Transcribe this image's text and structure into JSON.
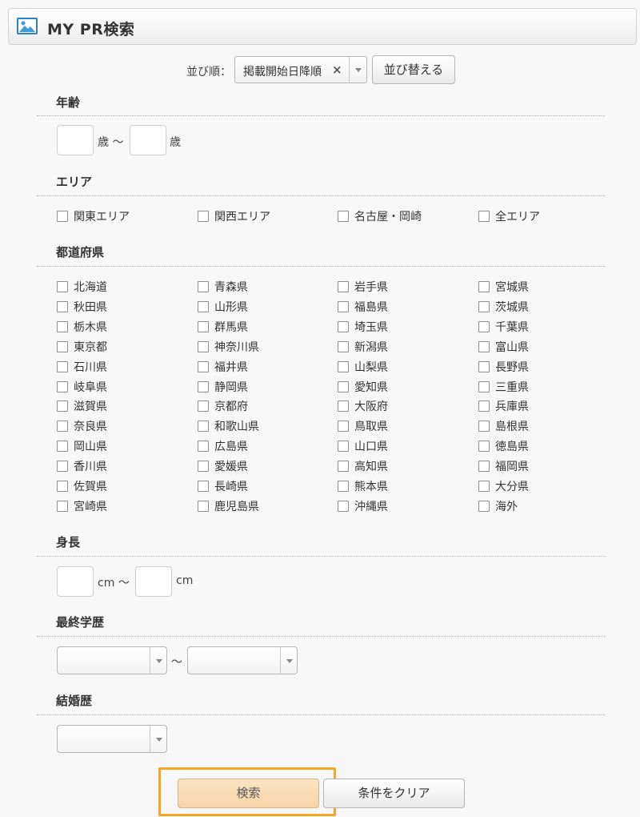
{
  "header": {
    "title": "MY PR検索",
    "icon": "image-icon"
  },
  "sort": {
    "label": "並び順：",
    "selected": "掲載開始日降順",
    "clear": "×",
    "button": "並び替える"
  },
  "age": {
    "title": "年齢",
    "unit_from": "歳 ～",
    "unit_to": "歳"
  },
  "area": {
    "title": "エリア",
    "items": [
      "関東エリア",
      "関西エリア",
      "名古屋・岡崎",
      "全エリア"
    ]
  },
  "prefecture": {
    "title": "都道府県",
    "rows": [
      [
        "北海道",
        "青森県",
        "岩手県",
        "宮城県"
      ],
      [
        "秋田県",
        "山形県",
        "福島県",
        "茨城県"
      ],
      [
        "栃木県",
        "群馬県",
        "埼玉県",
        "千葉県"
      ],
      [
        "東京都",
        "神奈川県",
        "新潟県",
        "富山県"
      ],
      [
        "石川県",
        "福井県",
        "山梨県",
        "長野県"
      ],
      [
        "岐阜県",
        "静岡県",
        "愛知県",
        "三重県"
      ],
      [
        "滋賀県",
        "京都府",
        "大阪府",
        "兵庫県"
      ],
      [
        "奈良県",
        "和歌山県",
        "鳥取県",
        "島根県"
      ],
      [
        "岡山県",
        "広島県",
        "山口県",
        "徳島県"
      ],
      [
        "香川県",
        "愛媛県",
        "高知県",
        "福岡県"
      ],
      [
        "佐賀県",
        "長崎県",
        "熊本県",
        "大分県"
      ],
      [
        "宮崎県",
        "鹿児島県",
        "沖縄県",
        "海外"
      ]
    ]
  },
  "height": {
    "title": "身長",
    "unit_from": "cm ～",
    "unit_to": "cm"
  },
  "education": {
    "title": "最終学歴",
    "separator": "～"
  },
  "marriage": {
    "title": "結婚歴"
  },
  "actions": {
    "search": "検索",
    "clear": "条件をクリア"
  }
}
